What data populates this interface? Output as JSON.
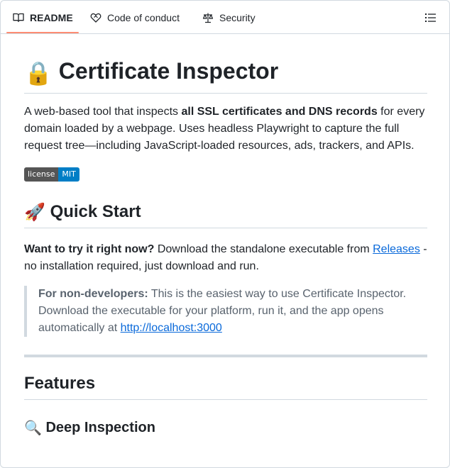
{
  "tabs": [
    {
      "label": "README",
      "icon": "book-icon",
      "active": true
    },
    {
      "label": "Code of conduct",
      "icon": "heart-handshake-icon",
      "active": false
    },
    {
      "label": "Security",
      "icon": "scale-icon",
      "active": false
    }
  ],
  "outline_icon": "list-unordered-icon",
  "readme": {
    "title_emoji": "🔒",
    "title": "Certificate Inspector",
    "intro": {
      "before": "A web-based tool that inspects ",
      "bold": "all SSL certificates and DNS records",
      "after": " for every domain loaded by a webpage. Uses headless Playwright to capture the full request tree—including JavaScript-loaded resources, ads, trackers, and APIs."
    },
    "badge": {
      "label": "license",
      "value": "MIT",
      "label_color": "#555555",
      "value_color": "#007ec6"
    },
    "quick_start": {
      "emoji": "🚀",
      "heading": "Quick Start",
      "lead_bold": "Want to try it right now?",
      "lead_text": " Download the standalone executable from ",
      "releases_link": "Releases",
      "lead_tail": " - no installation required, just download and run."
    },
    "note": {
      "bold": "For non-developers:",
      "text": " This is the easiest way to use Certificate Inspector. Download the executable for your platform, run it, and the app opens automatically at ",
      "link": "http://localhost:3000"
    },
    "features_heading": "Features",
    "deep_inspection": {
      "emoji": "🔍",
      "heading": "Deep Inspection"
    }
  },
  "colors": {
    "link": "#0969da",
    "tab_underline": "#fd8c73",
    "border": "#d1d9e0"
  }
}
